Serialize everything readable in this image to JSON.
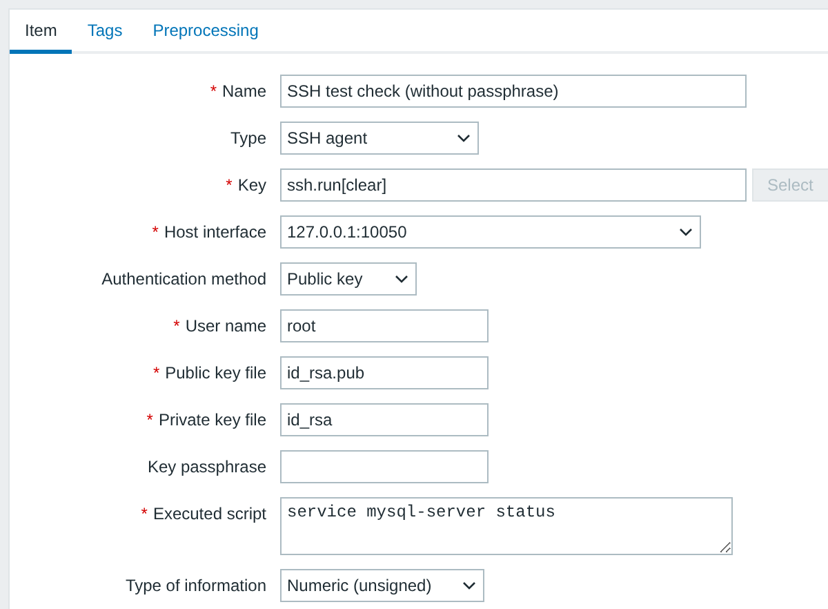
{
  "tabs": [
    {
      "label": "Item",
      "selected": true
    },
    {
      "label": "Tags",
      "selected": false
    },
    {
      "label": "Preprocessing",
      "selected": false
    }
  ],
  "fields": [
    {
      "label": "Name",
      "required_mark": "*",
      "kind": "text",
      "value": "SSH test check (without passphrase)"
    },
    {
      "label": "Type",
      "kind": "select",
      "value": "SSH agent"
    },
    {
      "label": "Key",
      "required_mark": "*",
      "kind": "text",
      "value": "ssh.run[clear]",
      "button": {
        "label": "Select",
        "disabled": true
      }
    },
    {
      "label": "Host interface",
      "required_mark": "*",
      "kind": "select",
      "value": "127.0.0.1:10050"
    },
    {
      "label": "Authentication method",
      "kind": "select",
      "value": "Public key"
    },
    {
      "label": "User name",
      "required_mark": "*",
      "kind": "text",
      "value": "root"
    },
    {
      "label": "Public key file",
      "required_mark": "*",
      "kind": "text",
      "value": "id_rsa.pub"
    },
    {
      "label": "Private key file",
      "required_mark": "*",
      "kind": "text",
      "value": "id_rsa"
    },
    {
      "label": "Key passphrase",
      "kind": "text"
    },
    {
      "label": "Executed script",
      "required_mark": "*",
      "kind": "textarea",
      "value": "service mysql-server status"
    },
    {
      "label": "Type of information",
      "kind": "select",
      "value": "Numeric (unsigned)"
    }
  ]
}
